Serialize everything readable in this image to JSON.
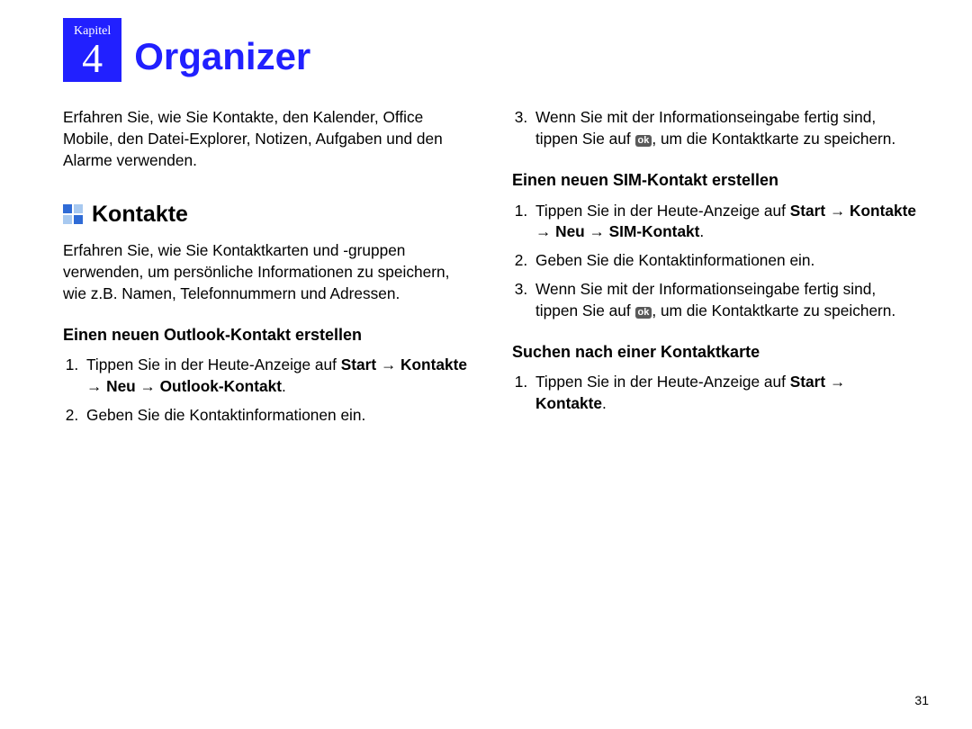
{
  "chapter": {
    "label": "Kapitel",
    "number": "4",
    "title": "Organizer"
  },
  "intro": "Erfahren Sie, wie Sie Kontakte, den Kalender, Office Mobile, den Datei-Explorer, Notizen, Aufgaben und den Alarme verwenden.",
  "contacts": {
    "heading": "Kontakte",
    "desc": "Erfahren Sie, wie Sie Kontaktkarten und -gruppen verwenden, um persönliche Informationen zu speichern, wie z.B. Namen, Telefonnummern und Adressen."
  },
  "outlook": {
    "heading": "Einen neuen Outlook-Kontakt erstellen",
    "step1_a": "Tippen Sie in der Heute-Anzeige auf ",
    "step1_b": "Start → Kontakte → Neu → Outlook-Kontakt",
    "step1_c": ".",
    "step2": "Geben Sie die Kontaktinformationen ein."
  },
  "save_step": {
    "a": "Wenn Sie mit der Informationseingabe fertig sind, tippen Sie auf ",
    "ok": "ok",
    "b": ", um die Kontaktkarte zu speichern."
  },
  "sim": {
    "heading": "Einen neuen SIM-Kontakt erstellen",
    "step1_a": "Tippen Sie in der Heute-Anzeige auf ",
    "step1_b": "Start → Kontakte → Neu → SIM-Kontakt",
    "step1_c": ".",
    "step2": "Geben Sie die Kontaktinformationen ein."
  },
  "search": {
    "heading": "Suchen nach einer Kontaktkarte",
    "step1_a": "Tippen Sie in der Heute-Anzeige auf ",
    "step1_b": "Start → Kontakte",
    "step1_c": "."
  },
  "page_number": "31"
}
